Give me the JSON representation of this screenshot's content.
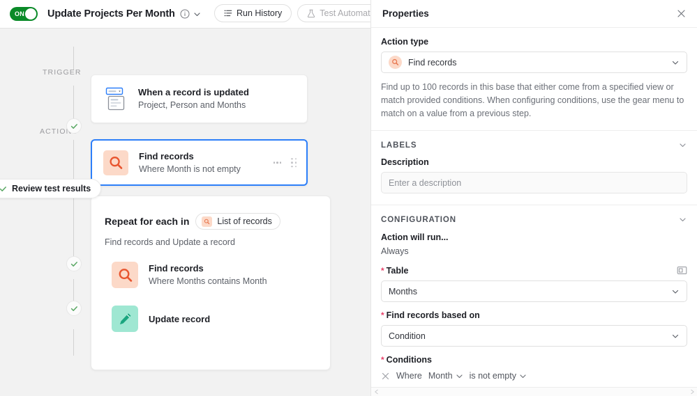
{
  "topbar": {
    "toggle_label": "ON",
    "toggle_state": "on",
    "title": "Update Projects Per Month",
    "info_icon": "info-circle-icon",
    "chevron_icon": "chevron-down-icon",
    "buttons": [
      {
        "label": "Run History",
        "icon": "list-history-icon",
        "disabled": false
      },
      {
        "label": "Test Automation",
        "icon": "flask-icon",
        "disabled": true
      }
    ]
  },
  "flow": {
    "trigger_label": "TRIGGER",
    "actions_label": "ACTIONS",
    "review_pill": {
      "label": "Review test results",
      "icon": "check-icon"
    },
    "trigger_step": {
      "title": "When a record is updated",
      "subtitle": "Project, Person and Months",
      "icon": "record-updated-icon"
    },
    "selected_step": {
      "title": "Find records",
      "subtitle": "Where Month is not empty",
      "icon": "magnifier-icon",
      "menu_icon": "ellipsis-icon",
      "drag_icon": "drag-handle-icon",
      "selected": true
    },
    "repeat_group": {
      "heading": "Repeat for each in",
      "chip_label": "List of records",
      "chip_icon": "magnifier-icon",
      "subtitle": "Find records and Update a record",
      "steps": [
        {
          "title": "Find records",
          "subtitle": "Where Months contains Month",
          "icon": "magnifier-icon"
        },
        {
          "title": "Update record",
          "subtitle": "",
          "icon": "pencil-icon"
        }
      ]
    }
  },
  "properties": {
    "header_title": "Properties",
    "close_icon": "close-icon",
    "action_type": {
      "label": "Action type",
      "value": "Find records",
      "icon": "magnifier-icon",
      "caret_icon": "chevron-down-icon"
    },
    "helper_text": "Find up to 100 records in this base that either come from a specified view or match provided conditions. When configuring conditions, use the gear menu to match on a value from a previous step.",
    "labels_section": {
      "heading": "LABELS",
      "collapse_icon": "chevron-down-icon",
      "description_label": "Description",
      "description_value": "",
      "description_placeholder": "Enter a description"
    },
    "configuration_section": {
      "heading": "CONFIGURATION",
      "collapse_icon": "chevron-down-icon",
      "run_label": "Action will run...",
      "run_value": "Always",
      "table_label": "Table",
      "table_value": "Months",
      "table_expand_icon": "expand-record-icon",
      "based_on_label": "Find records based on",
      "based_on_value": "Condition",
      "conditions_label": "Conditions",
      "condition_row": {
        "remove_icon": "close-icon",
        "where": "Where",
        "field": "Month",
        "operator": "is not empty"
      },
      "required_marker": "*"
    }
  },
  "scrollbar": {
    "left_arrow_icon": "triangle-left-icon",
    "right_arrow_icon": "triangle-right-icon"
  }
}
